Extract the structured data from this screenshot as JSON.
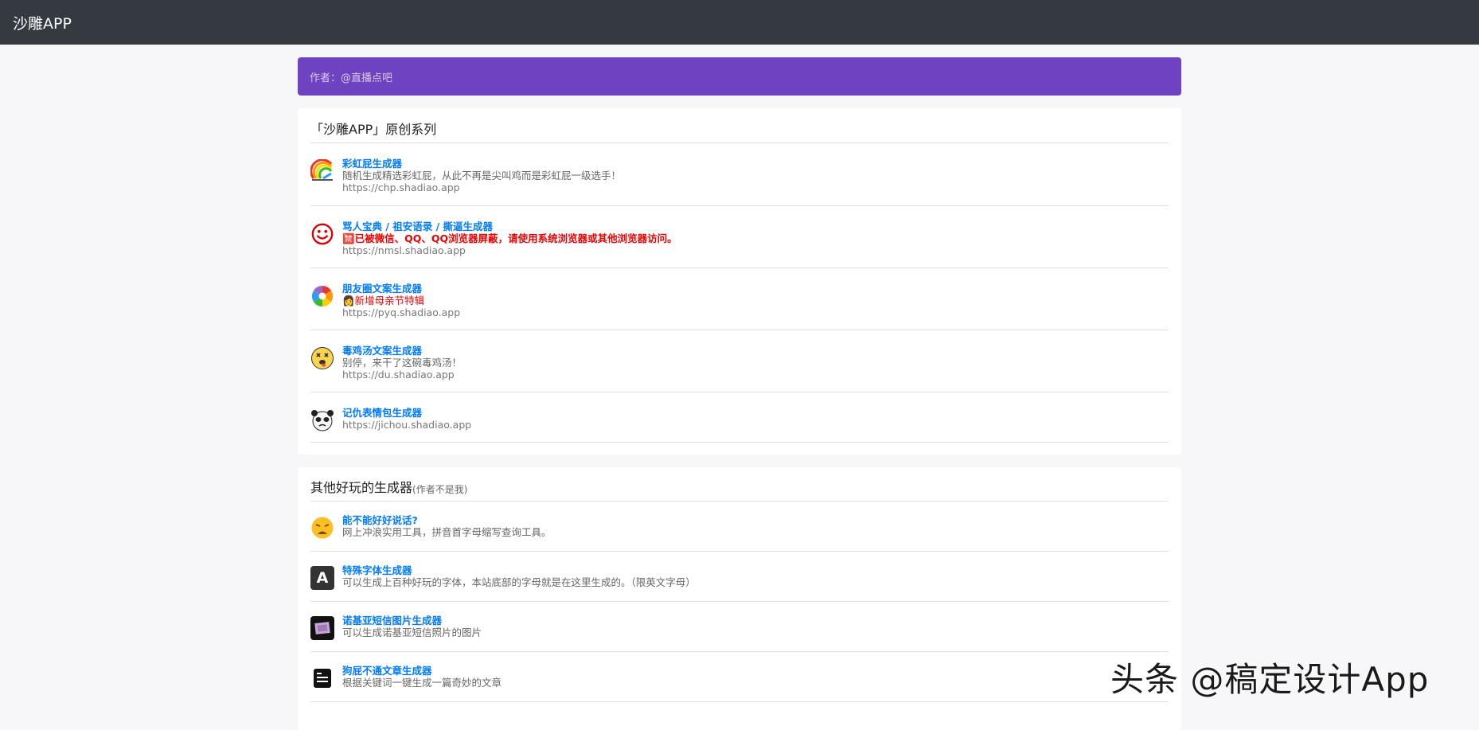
{
  "navbar": {
    "brand": "沙雕APP"
  },
  "alert": {
    "text": "作者：@直播点吧"
  },
  "original": {
    "title": "「沙雕APP」原创系列",
    "items": [
      {
        "title": "彩虹屁生成器",
        "desc": "随机生成精选彩虹屁，从此不再是尖叫鸡而是彩虹屁一级选手！",
        "url": "https://chp.shadiao.app",
        "icon": "rainbow-icon"
      },
      {
        "title": "骂人宝典 / 祖安语录 / 撕逼生成器",
        "desc": "🈲已被微信、QQ、QQ浏览器屏蔽，请使用系统浏览器或其他浏览器访问。",
        "url": "https://nmsl.shadiao.app",
        "icon": "smiley-icon"
      },
      {
        "title": "朋友圈文案生成器",
        "desc": "👩新增母亲节特辑",
        "url": "https://pyq.shadiao.app",
        "icon": "aperture-icon"
      },
      {
        "title": "毒鸡汤文案生成器",
        "desc": "别停，来干了这碗毒鸡汤！",
        "url": "https://du.shadiao.app",
        "icon": "dizzy-face-icon"
      },
      {
        "title": "记仇表情包生成器",
        "desc": "",
        "url": "https://jichou.shadiao.app",
        "icon": "panda-meme-icon"
      }
    ]
  },
  "others": {
    "title": "其他好玩的生成器",
    "subtitle": "(作者不是我)",
    "items": [
      {
        "title": "能不能好好说话?",
        "desc": "网上冲浪实用工具，拼音首字母缩写查询工具。",
        "icon": "weary-face-icon"
      },
      {
        "title": "特殊字体生成器",
        "desc": "可以生成上百种好玩的字体，本站底部的字母就是在这里生成的。（限英文字母）",
        "icon": "letter-a-icon",
        "glyph": "A"
      },
      {
        "title": "诺基亚短信图片生成器",
        "desc": "可以生成诺基亚短信照片的图片",
        "icon": "nokia-sms-icon"
      },
      {
        "title": "狗屁不通文章生成器",
        "desc": "根据关键词一键生成一篇奇妙的文章",
        "icon": "document-icon"
      }
    ]
  },
  "watermark": {
    "text": "头条 @稿定设计App"
  },
  "colors": {
    "navbar": "#343a40",
    "alert": "#6f42c1",
    "link": "#007bff",
    "warning": "#e00000"
  }
}
